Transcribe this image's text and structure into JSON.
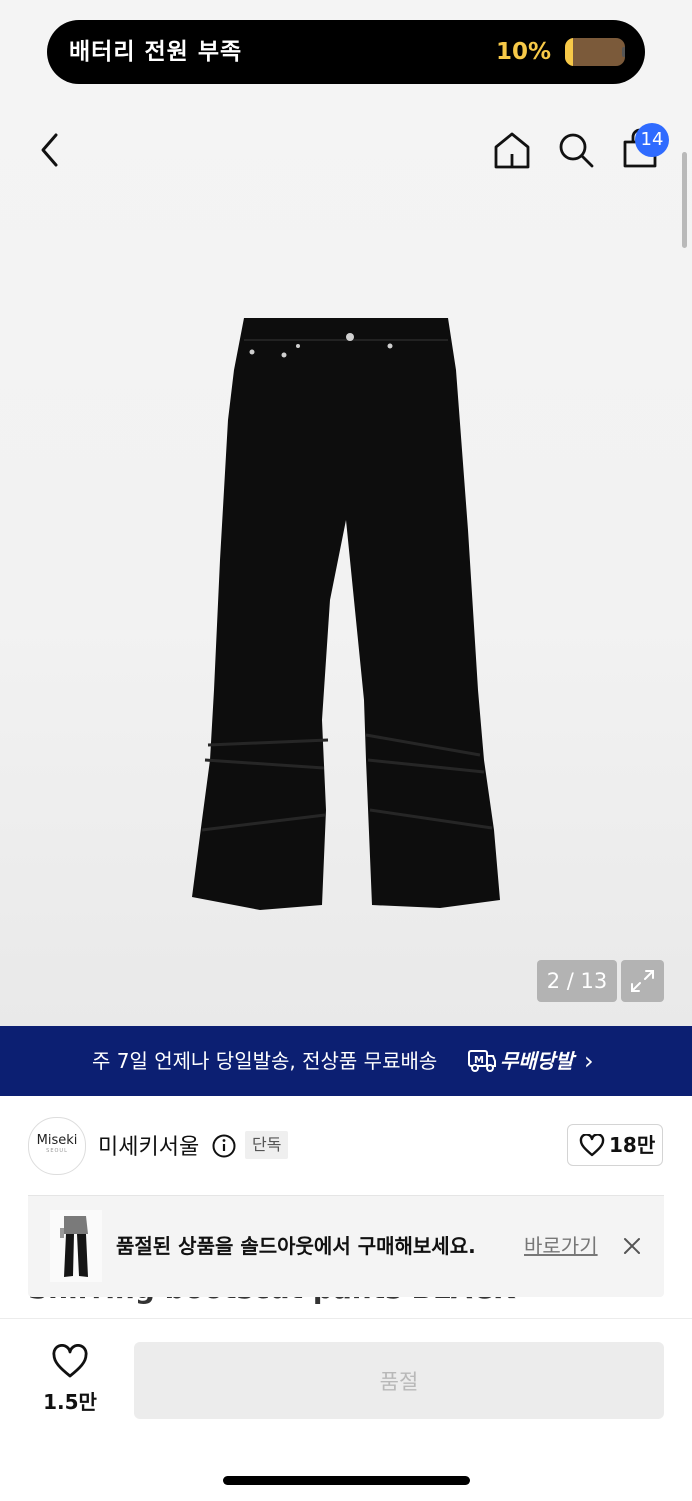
{
  "status": {
    "battery_message": "배터리 전원 부족",
    "battery_percent": "10%",
    "battery_level": 0.1
  },
  "nav": {
    "cart_count": "14",
    "icons": [
      "back-icon",
      "home-icon",
      "search-icon",
      "shopping-bag-icon"
    ]
  },
  "gallery": {
    "counter": "2 / 13",
    "expand_icon": "expand-icon"
  },
  "delivery_banner": {
    "text": "주 7일 언제나 당일발송, 전상품 무료배송",
    "brand": "무배당발",
    "chevron": "›",
    "color": "#0c1f72"
  },
  "seller": {
    "logo_text": "Miseki",
    "logo_sub": "SEOUL",
    "name": "미세키서울",
    "exclusive_badge": "단독",
    "like_count": "18만"
  },
  "product": {
    "title_partial": "Shirring bootscut pants BLACK"
  },
  "soldout_toast": {
    "message": "품절된 상품을 솔드아웃에서 구매해보세요.",
    "link": "바로가기"
  },
  "bottom_bar": {
    "wish_count": "1.5만",
    "buy_button": "품절"
  },
  "colors": {
    "badge_blue": "#2f6bff",
    "battery_yellow": "#f7c948"
  }
}
